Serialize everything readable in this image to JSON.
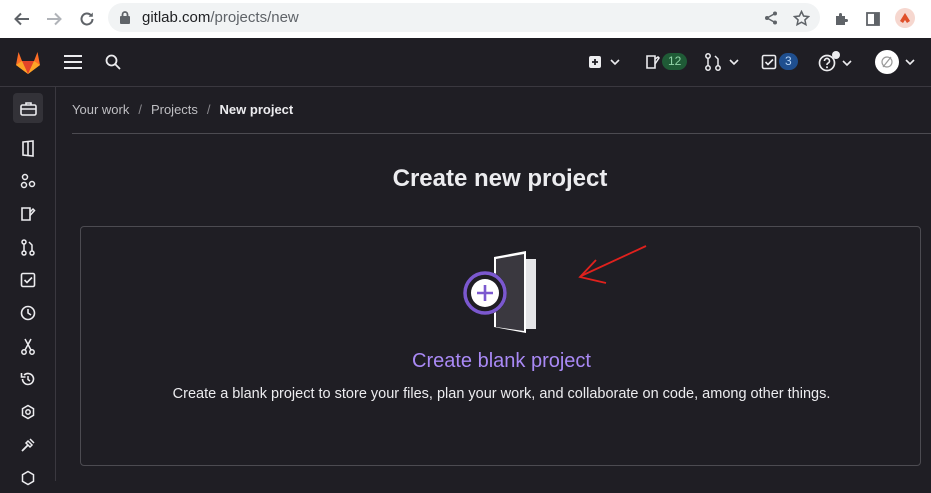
{
  "browser": {
    "url_host": "gitlab.com",
    "url_path": "/projects/new",
    "icons": [
      "back-arrow-icon",
      "forward-arrow-icon",
      "reload-icon",
      "lock-icon",
      "share-icon",
      "bookmark-star-icon",
      "extensions-icon",
      "sidepanel-icon",
      "profile-icon"
    ]
  },
  "header": {
    "icons": [
      "gitlab-logo",
      "menu-icon",
      "search-icon",
      "new-plus-icon",
      "issues-icon",
      "merge-requests-icon",
      "todos-icon",
      "help-icon",
      "user-avatar"
    ],
    "issues_count": "12",
    "todos_count": "3"
  },
  "sidebar": {
    "icons": [
      "work-icon",
      "projects-icon",
      "groups-icon",
      "issues-icon",
      "merge-requests-icon",
      "todos-icon",
      "milestones-icon",
      "snippets-icon",
      "activity-icon",
      "environments-icon",
      "operations-icon",
      "security-icon"
    ]
  },
  "breadcrumb": {
    "item1": "Your work",
    "item2": "Projects",
    "item3": "New project"
  },
  "main": {
    "title": "Create new project",
    "card_title": "Create blank project",
    "card_description": "Create a blank project to store your files, plan your work, and collaborate on code, among other things."
  },
  "colors": {
    "background": "#1f1e24",
    "accent_purple": "#a989f5",
    "annotation_red": "#e0211d",
    "issues_badge": "#1f5b36",
    "todos_badge": "#1f4f8f"
  }
}
